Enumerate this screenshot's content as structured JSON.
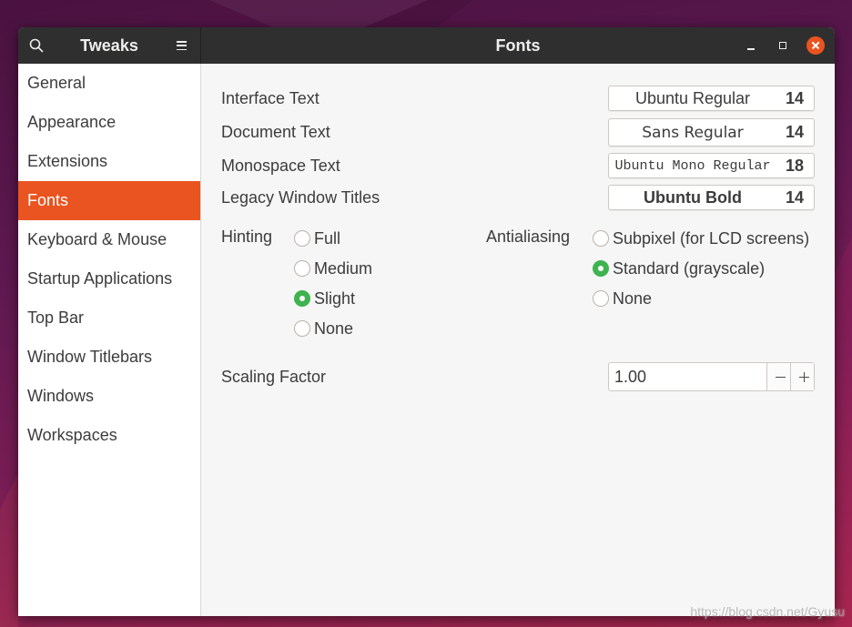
{
  "window": {
    "app_title": "Tweaks",
    "page_title": "Fonts"
  },
  "header": {
    "search_icon": "search-icon",
    "menu_icon": "hamburger-menu-icon",
    "minimize_icon": "minimize-icon",
    "maximize_icon": "maximize-icon",
    "close_icon": "close-icon"
  },
  "sidebar": {
    "items": [
      {
        "label": "General",
        "selected": false
      },
      {
        "label": "Appearance",
        "selected": false
      },
      {
        "label": "Extensions",
        "selected": false
      },
      {
        "label": "Fonts",
        "selected": true
      },
      {
        "label": "Keyboard & Mouse",
        "selected": false
      },
      {
        "label": "Startup Applications",
        "selected": false
      },
      {
        "label": "Top Bar",
        "selected": false
      },
      {
        "label": "Window Titlebars",
        "selected": false
      },
      {
        "label": "Windows",
        "selected": false
      },
      {
        "label": "Workspaces",
        "selected": false
      }
    ]
  },
  "fonts": [
    {
      "label": "Interface Text",
      "font": "Ubuntu Regular",
      "size": "14"
    },
    {
      "label": "Document Text",
      "font": "Sans Regular",
      "size": "14"
    },
    {
      "label": "Monospace Text",
      "font": "Ubuntu Mono Regular",
      "size": "18"
    },
    {
      "label": "Legacy Window Titles",
      "font": "Ubuntu Bold",
      "size": "14"
    }
  ],
  "hinting": {
    "label": "Hinting",
    "options": [
      {
        "label": "Full",
        "checked": false
      },
      {
        "label": "Medium",
        "checked": false
      },
      {
        "label": "Slight",
        "checked": true
      },
      {
        "label": "None",
        "checked": false
      }
    ]
  },
  "antialiasing": {
    "label": "Antialiasing",
    "options": [
      {
        "label": "Subpixel (for LCD screens)",
        "checked": false
      },
      {
        "label": "Standard (grayscale)",
        "checked": true
      },
      {
        "label": "None",
        "checked": false
      }
    ]
  },
  "scaling": {
    "label": "Scaling Factor",
    "value": "1.00",
    "decrement_icon": "minus-icon",
    "increment_icon": "plus-icon"
  },
  "colors": {
    "accent": "#e95420",
    "radio_checked": "#3eb34f",
    "close_button": "#e95420",
    "header_bg": "#2f2f2f",
    "sidebar_bg": "#ffffff",
    "content_bg": "#f6f6f6"
  },
  "watermark": "https://blog.csdn.net/Gyusu"
}
